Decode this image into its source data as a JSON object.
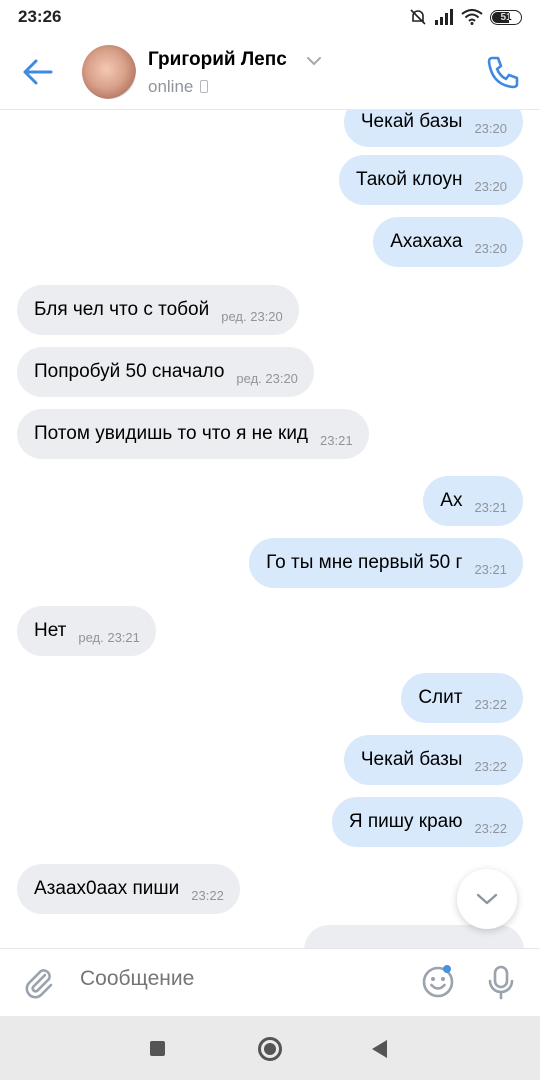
{
  "status_bar": {
    "time": "23:26",
    "battery": "51"
  },
  "header": {
    "contact_name": "Григорий Лепс",
    "status": "online"
  },
  "messages": [
    {
      "dir": "out",
      "text": "Чекай базы",
      "meta": "23:20"
    },
    {
      "dir": "out",
      "text": "Такой клоун",
      "meta": "23:20"
    },
    {
      "dir": "out",
      "text": "Ахахаха",
      "meta": "23:20"
    },
    {
      "dir": "in",
      "text": "Бля чел что с тобой",
      "meta": "ред. 23:20"
    },
    {
      "dir": "in",
      "text": "Попробуй 50 сначало",
      "meta": "ред. 23:20"
    },
    {
      "dir": "in",
      "text": "Потом увидишь то что я не кид",
      "meta": "23:21"
    },
    {
      "dir": "out",
      "text": "Ах",
      "meta": "23:21"
    },
    {
      "dir": "out",
      "text": "Го ты мне первый 50 г",
      "meta": "23:21"
    },
    {
      "dir": "in",
      "text": "Нет",
      "meta": "ред. 23:21"
    },
    {
      "dir": "out",
      "text": "Слит",
      "meta": "23:22"
    },
    {
      "dir": "out",
      "text": "Чекай базы",
      "meta": "23:22"
    },
    {
      "dir": "out",
      "text": "Я пишу краю",
      "meta": "23:22"
    },
    {
      "dir": "in",
      "text": "Азаах0аах пиши",
      "meta": "23:22"
    },
    {
      "dir": "out",
      "text": "",
      "meta": ""
    }
  ],
  "composer": {
    "placeholder": "Сообщение"
  },
  "icons": {
    "back": "arrow-left-icon",
    "phone": "phone-icon",
    "attach": "paperclip-icon",
    "emoji": "smiley-icon",
    "mic": "microphone-icon",
    "scroll": "chevron-down-icon"
  },
  "colors": {
    "accent": "#3f8ae0",
    "out_bubble": "#d8e9fb",
    "in_bubble": "#ebedf0",
    "meta_text": "#8f959c"
  }
}
